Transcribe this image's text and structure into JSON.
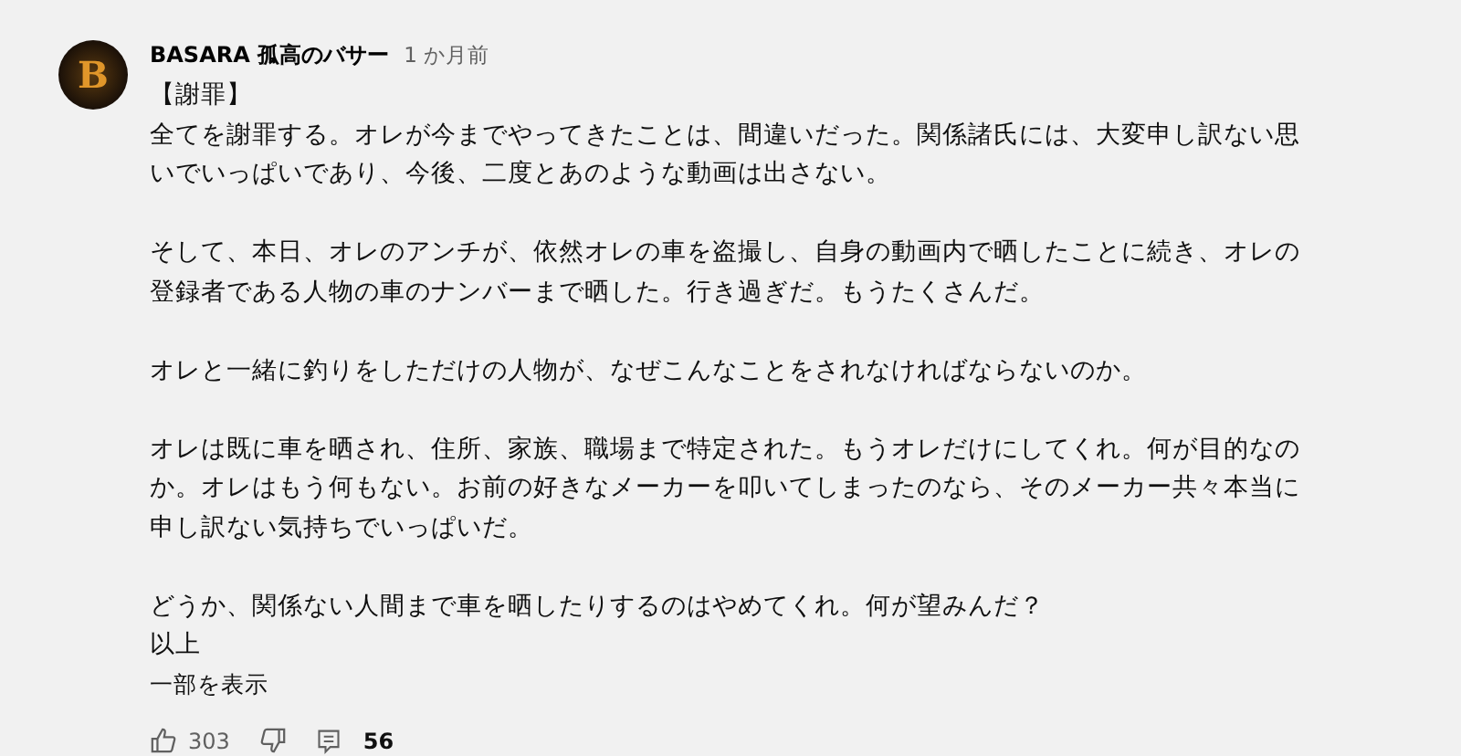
{
  "comment": {
    "avatar_letter": "B",
    "author": "BASARA 孤高のバサー",
    "time": "1 か月前",
    "paragraphs": [
      [
        "【謝罪】",
        "全てを謝罪する。オレが今までやってきたことは、間違いだった。関係諸氏には、大変申し訳ない思",
        "いでいっぱいであり、今後、二度とあのような動画は出さない。"
      ],
      [
        "そして、本日、オレのアンチが、依然オレの車を盗撮し、自身の動画内で晒したことに続き、オレの",
        "登録者である人物の車のナンバーまで晒した。行き過ぎだ。もうたくさんだ。"
      ],
      [
        "オレと一緒に釣りをしただけの人物が、なぜこんなことをされなければならないのか。"
      ],
      [
        "オレは既に車を晒され、住所、家族、職場まで特定された。もうオレだけにしてくれ。何が目的なの",
        "か。オレはもう何もない。お前の好きなメーカーを叩いてしまったのなら、そのメーカー共々本当に",
        "申し訳ない気持ちでいっぱいだ。"
      ],
      [
        "どうか、関係ない人間まで車を晒したりするのはやめてくれ。何が望みんだ？",
        "以上"
      ]
    ],
    "show_less": "一部を表示",
    "likes": "303",
    "replies": "56"
  }
}
